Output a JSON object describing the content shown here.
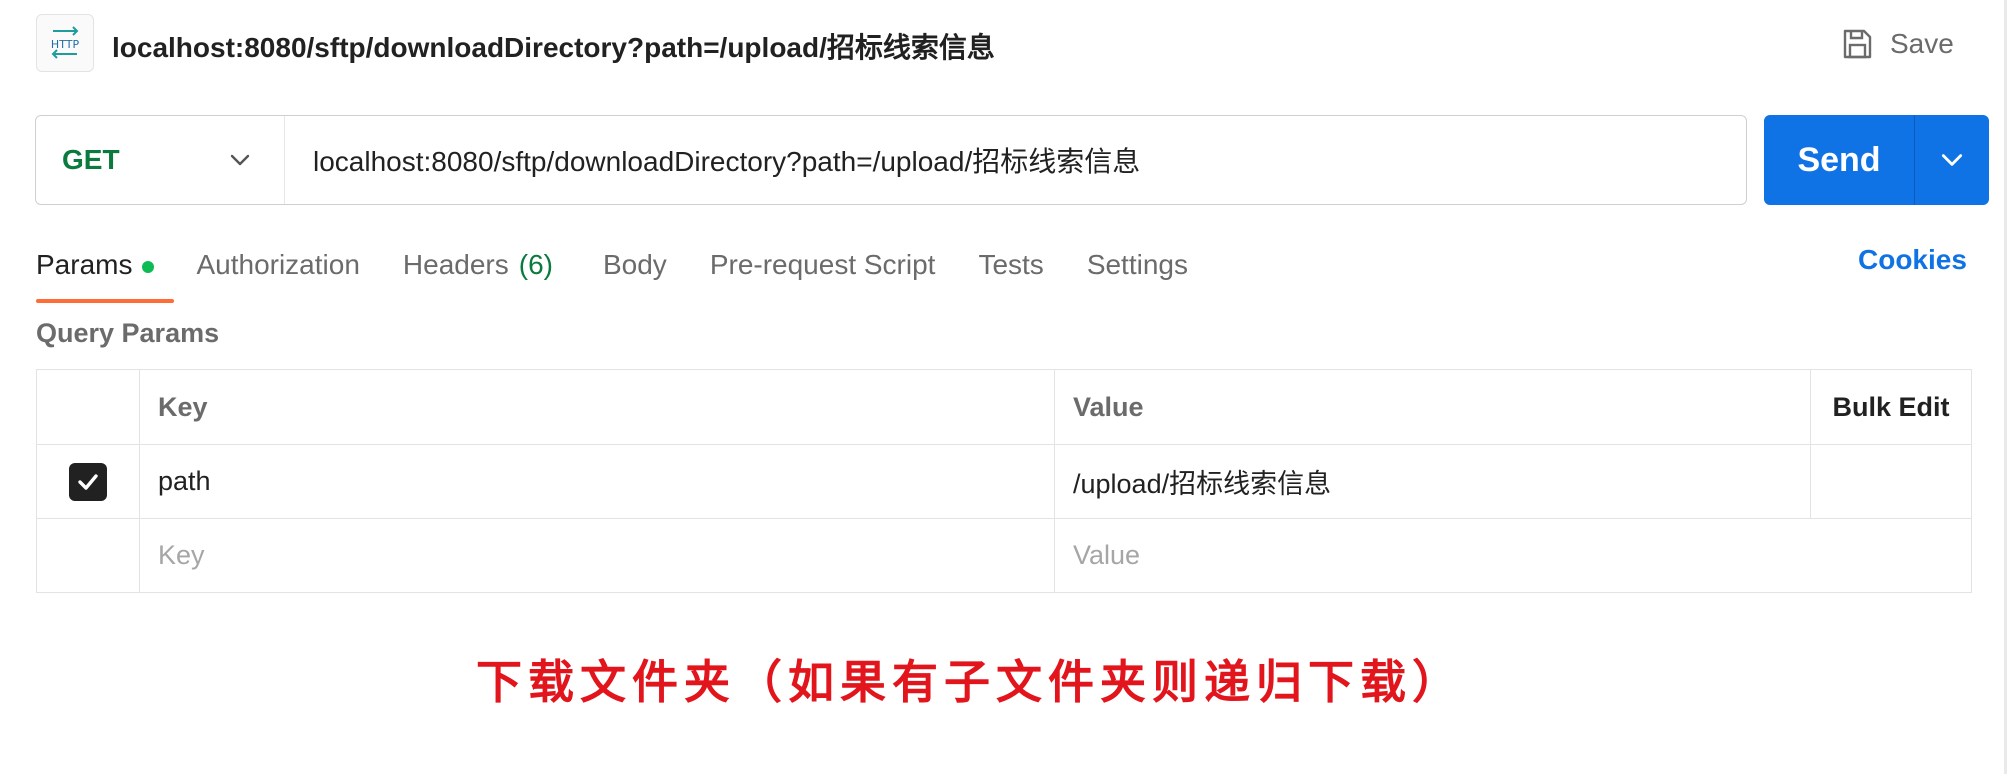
{
  "header": {
    "badge_icon": "http-icon",
    "title": "localhost:8080/sftp/downloadDirectory?path=/upload/招标线索信息",
    "save_label": "Save"
  },
  "request": {
    "method": "GET",
    "url": "localhost:8080/sftp/downloadDirectory?path=/upload/招标线索信息",
    "send_label": "Send"
  },
  "tabs": [
    {
      "label": "Params",
      "active": true,
      "indicator": "green-dot"
    },
    {
      "label": "Authorization"
    },
    {
      "label": "Headers",
      "count": "(6)"
    },
    {
      "label": "Body"
    },
    {
      "label": "Pre-request Script"
    },
    {
      "label": "Tests"
    },
    {
      "label": "Settings"
    }
  ],
  "cookies_label": "Cookies",
  "query_params": {
    "title": "Query Params",
    "columns": {
      "key": "Key",
      "value": "Value",
      "bulk_edit": "Bulk Edit"
    },
    "rows": [
      {
        "checked": true,
        "key": "path",
        "value": "/upload/招标线索信息"
      }
    ],
    "empty_row": {
      "key_placeholder": "Key",
      "value_placeholder": "Value"
    }
  },
  "annotation": "下载文件夹（如果有子文件夹则递归下载）",
  "colors": {
    "accent_blue": "#0f72e5",
    "method_green": "#0b7a3e",
    "active_tab_underline": "#ff6c37",
    "annotation_red": "#e2141c"
  }
}
